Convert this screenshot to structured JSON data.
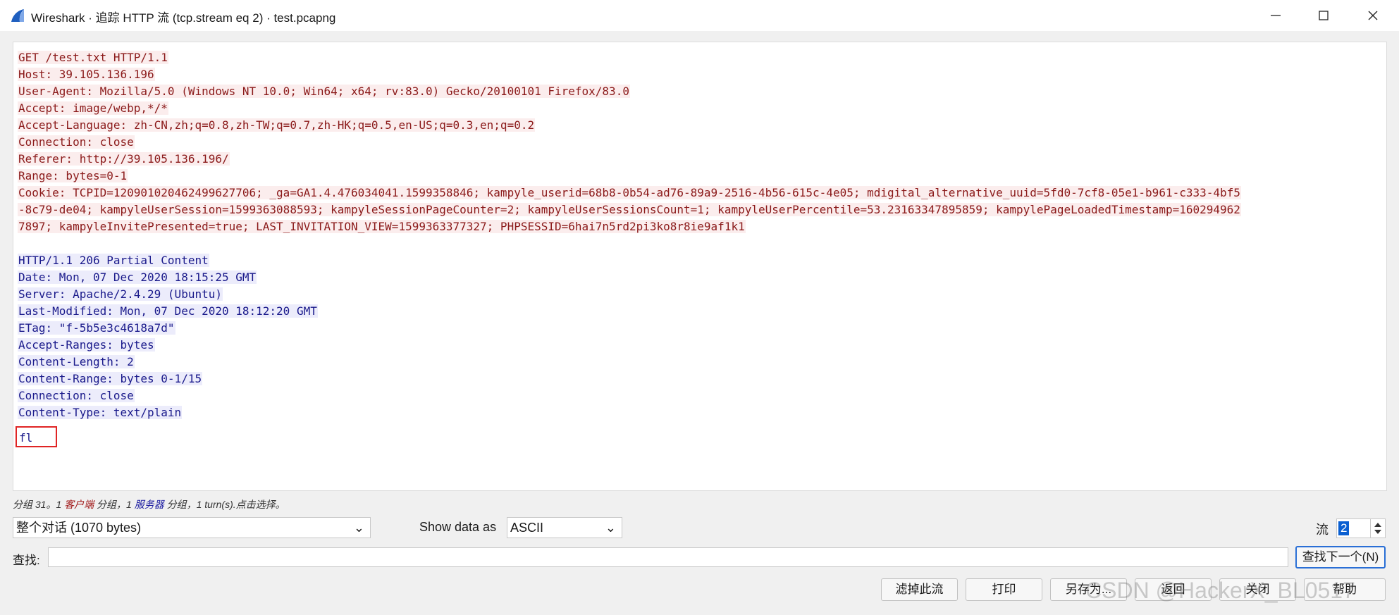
{
  "window": {
    "title": "Wireshark · 追踪 HTTP 流 (tcp.stream eq 2) · test.pcapng",
    "minimize": "—",
    "maximize": "☐",
    "close": "✕"
  },
  "stream": {
    "request_lines": [
      "GET /test.txt HTTP/1.1",
      "Host: 39.105.136.196",
      "User-Agent: Mozilla/5.0 (Windows NT 10.0; Win64; x64; rv:83.0) Gecko/20100101 Firefox/83.0",
      "Accept: image/webp,*/*",
      "Accept-Language: zh-CN,zh;q=0.8,zh-TW;q=0.7,zh-HK;q=0.5,en-US;q=0.3,en;q=0.2",
      "Connection: close",
      "Referer: http://39.105.136.196/",
      "Range: bytes=0-1",
      "Cookie: TCPID=120901020462499627706; _ga=GA1.4.476034041.1599358846; kampyle_userid=68b8-0b54-ad76-89a9-2516-4b56-615c-4e05; mdigital_alternative_uuid=5fd0-7cf8-05e1-b961-c333-4bf5",
      "-8c79-de04; kampyleUserSession=1599363088593; kampyleSessionPageCounter=2; kampyleUserSessionsCount=1; kampyleUserPercentile=53.23163347895859; kampylePageLoadedTimestamp=160294962",
      "7897; kampyleInvitePresented=true; LAST_INVITATION_VIEW=1599363377327; PHPSESSID=6hai7n5rd2pi3ko8r8ie9af1k1"
    ],
    "response_lines": [
      "HTTP/1.1 206 Partial Content",
      "Date: Mon, 07 Dec 2020 18:15:25 GMT",
      "Server: Apache/2.4.29 (Ubuntu)",
      "Last-Modified: Mon, 07 Dec 2020 18:12:20 GMT",
      "ETag: \"f-5b5e3c4618a7d\"",
      "Accept-Ranges: bytes",
      "Content-Length: 2",
      "Content-Range: bytes 0-1/15",
      "Connection: close",
      "Content-Type: text/plain"
    ],
    "payload": "fl"
  },
  "summary": {
    "prefix": "分组 31。1 ",
    "client_label": "客户端",
    "mid": " 分组，1 ",
    "server_label": "服务器",
    "suffix": " 分组，1 turn(s).点击选择。"
  },
  "controls": {
    "conversation_select": "整个对话 (1070 bytes)",
    "show_data_label": "Show data as",
    "show_data_value": "ASCII",
    "stream_label": "流",
    "stream_value": "2",
    "find_label": "查找:",
    "find_value": "",
    "find_next": "查找下一个(N)"
  },
  "buttons": {
    "filter_out": "滤掉此流",
    "print": "打印",
    "save_as": "另存为...",
    "back": "返回",
    "close": "关闭",
    "help": "帮助"
  },
  "watermark": "CSDN @HackerX_BL0517",
  "colors": {
    "client_text": "#8b1a1a",
    "client_bg": "#fbeded",
    "server_text": "#1a1a8b",
    "server_bg": "#ececfb",
    "highlight_box": "#e02424"
  }
}
